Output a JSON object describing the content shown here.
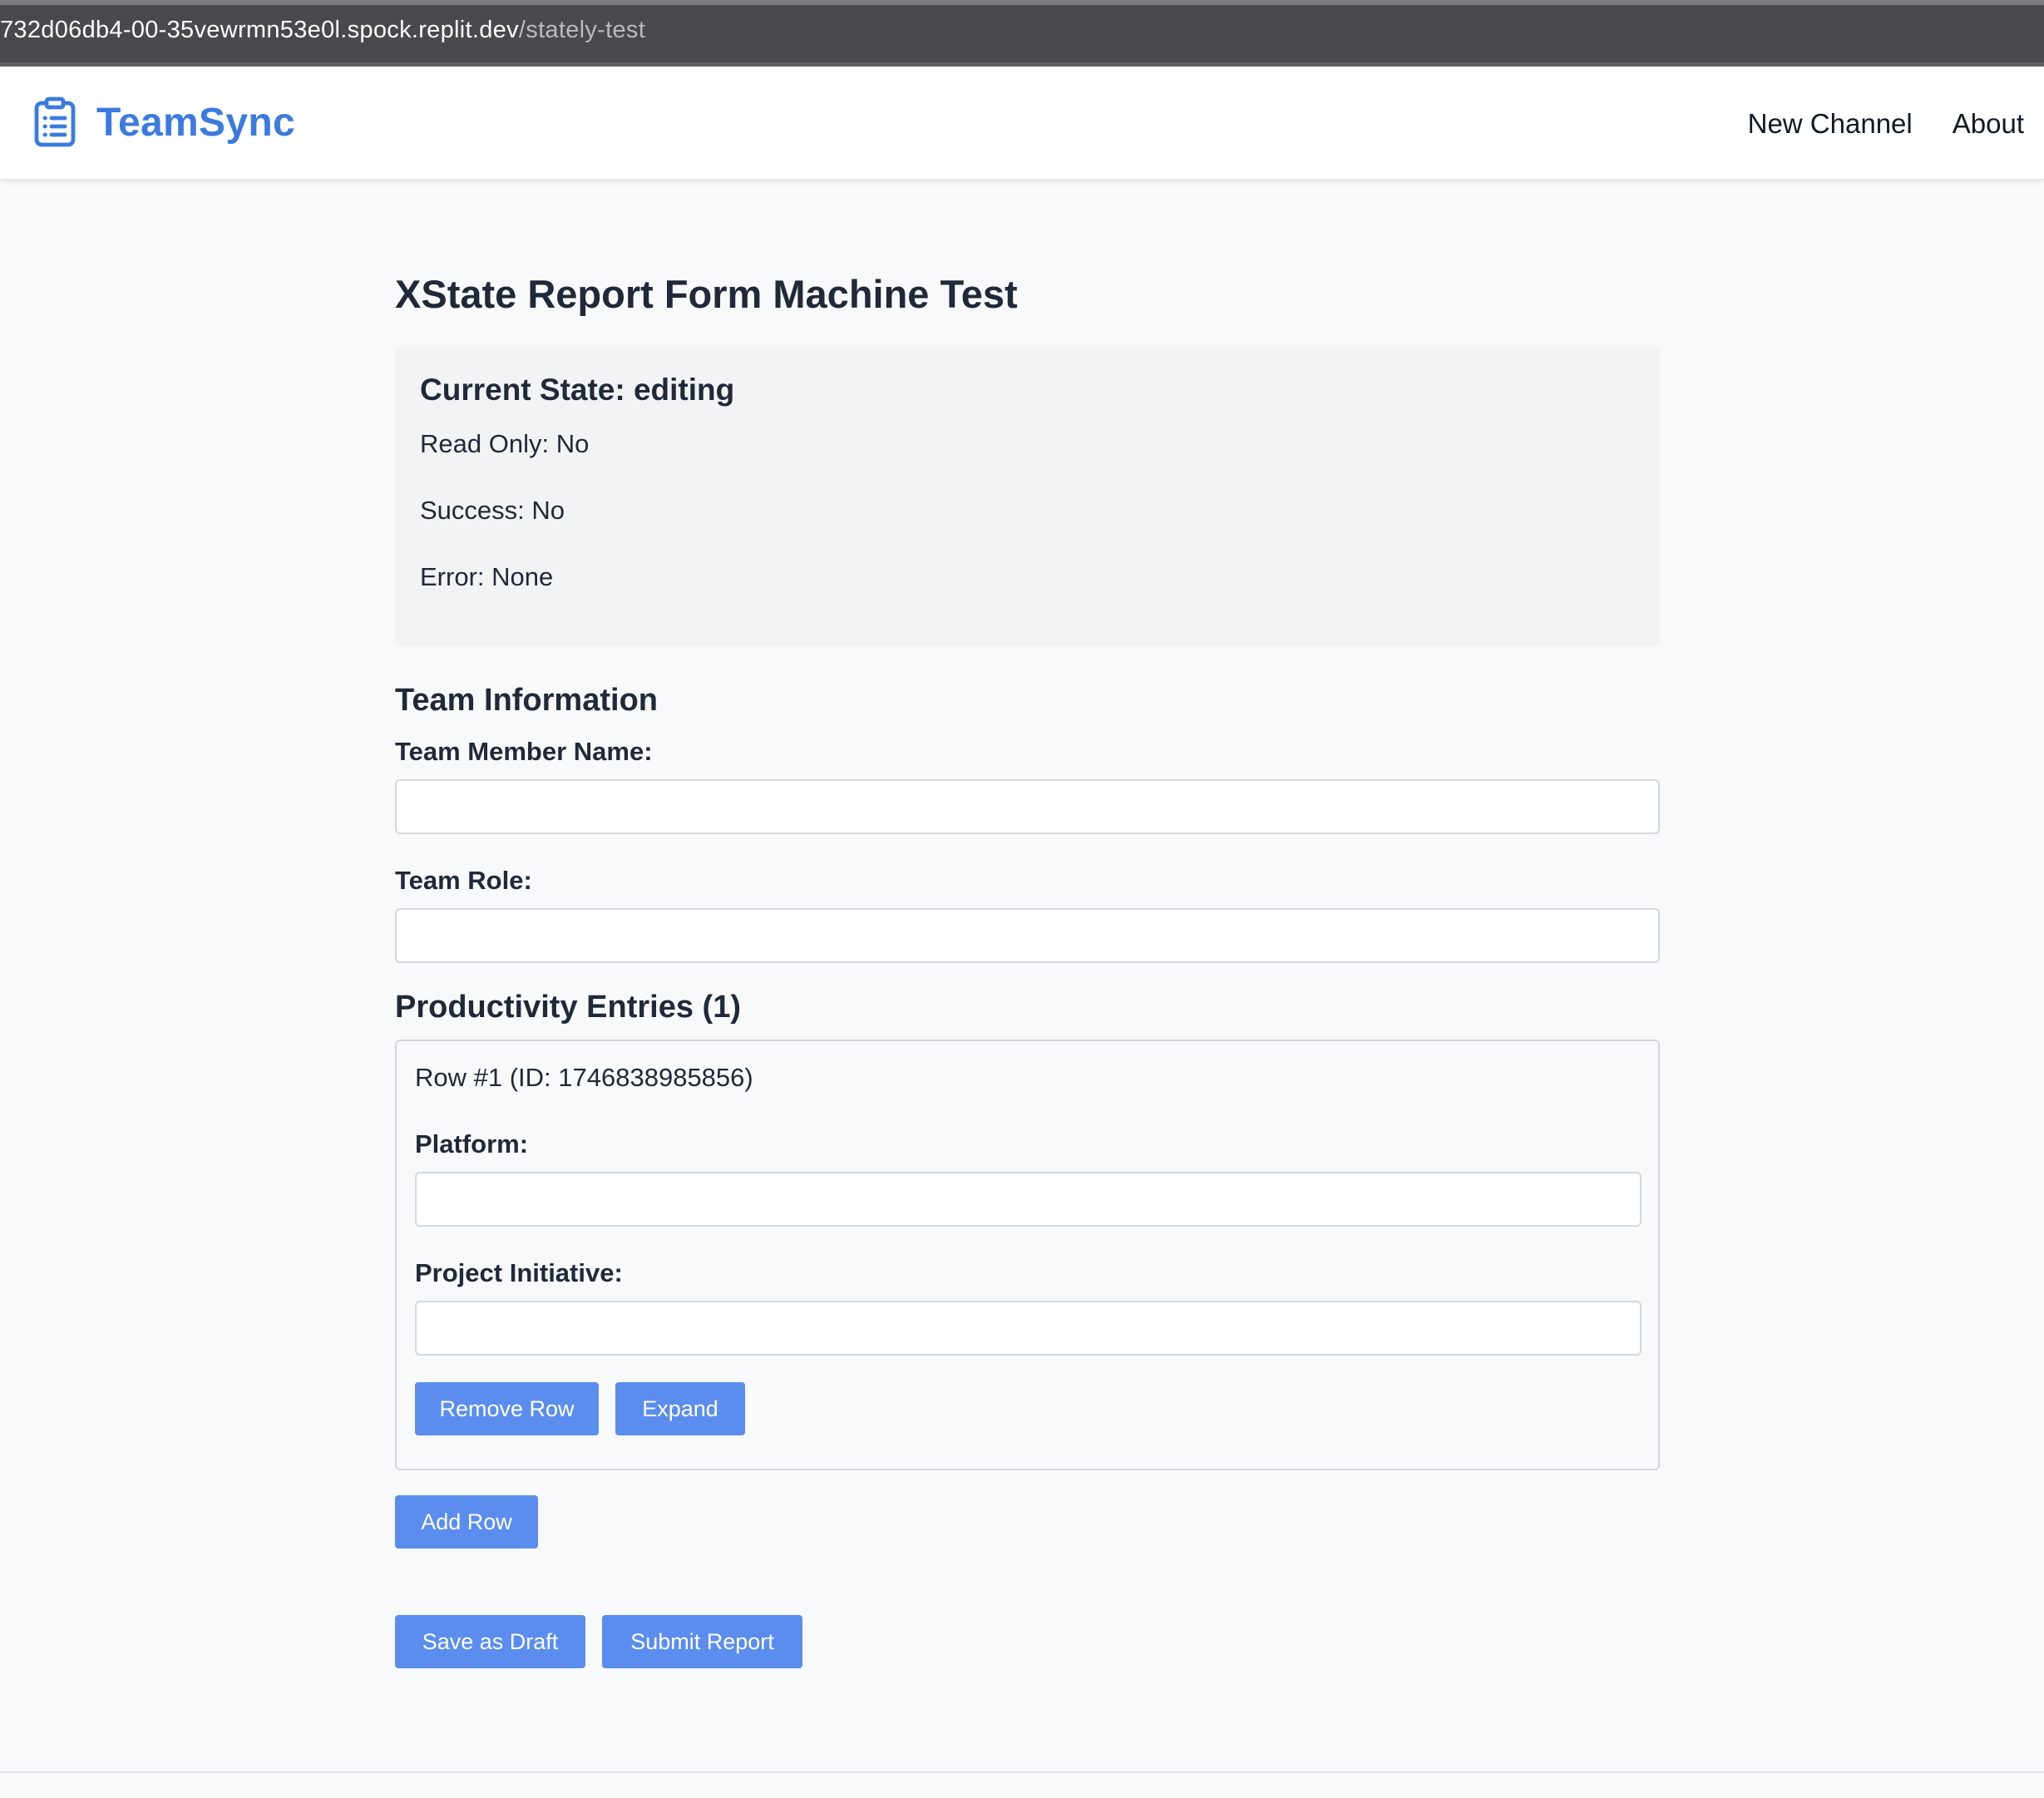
{
  "browser": {
    "url_host": "732d06db4-00-35vewrmn53e0l.spock.replit.dev",
    "url_path": "/stately-test"
  },
  "navbar": {
    "brand": "TeamSync",
    "brand_icon": "clipboard-list-icon",
    "accent_color": "#3b7be0",
    "links": [
      {
        "label": "New Channel"
      },
      {
        "label": "About"
      }
    ]
  },
  "page": {
    "title": "XState Report Form Machine Test"
  },
  "state_panel": {
    "title": "Current State: editing",
    "read_only": "Read Only: No",
    "success": "Success: No",
    "error": "Error: None"
  },
  "team_info": {
    "heading": "Team Information",
    "member_name_label": "Team Member Name:",
    "member_name_value": "",
    "role_label": "Team Role:",
    "role_value": ""
  },
  "entries": {
    "heading": "Productivity Entries (1)",
    "rows": [
      {
        "title": "Row #1 (ID: 1746838985856)",
        "platform_label": "Platform:",
        "platform_value": "",
        "initiative_label": "Project Initiative:",
        "initiative_value": "",
        "remove_label": "Remove Row",
        "expand_label": "Expand"
      }
    ],
    "add_row_label": "Add Row"
  },
  "actions": {
    "save_draft_label": "Save as Draft",
    "submit_label": "Submit Report",
    "button_color": "#5b8def"
  }
}
